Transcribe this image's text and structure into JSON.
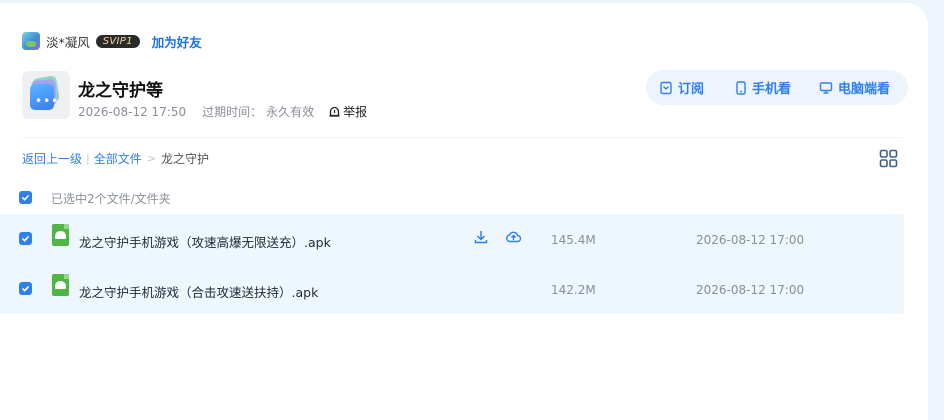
{
  "user": {
    "name": "淡*凝风",
    "vip": "SVIP1",
    "add_friend": "加为好友"
  },
  "share": {
    "title": "龙之守护等",
    "created": "2026-08-12 17:50",
    "expire_label": "过期时间：",
    "expire_value": "永久有效",
    "report": "举报"
  },
  "actions": {
    "subscribe": "订阅",
    "mobile": "手机看",
    "desktop": "电脑端看"
  },
  "breadcrumb": {
    "back": "返回上一级",
    "all_files": "全部文件",
    "separator": ">",
    "current": "龙之守护"
  },
  "selection": {
    "text": "已选中2个文件/文件夹"
  },
  "files": [
    {
      "name": "龙之守护手机游戏（攻速高爆无限送充）.apk",
      "size": "145.4M",
      "date": "2026-08-12 17:00",
      "checked": true
    },
    {
      "name": "龙之守护手机游戏（合击攻速送扶持）.apk",
      "size": "142.2M",
      "date": "2026-08-12 17:00",
      "checked": true
    }
  ],
  "colors": {
    "accent": "#2f80ed",
    "row_bg": "#eef6fe",
    "apk_green": "#4fb644",
    "vip_bg": "#2a2a2a"
  },
  "icons": [
    "subscribe-icon",
    "phone-icon",
    "monitor-icon",
    "report-icon",
    "grid-view-icon",
    "download-icon",
    "cloud-save-icon",
    "apk-file-icon"
  ]
}
